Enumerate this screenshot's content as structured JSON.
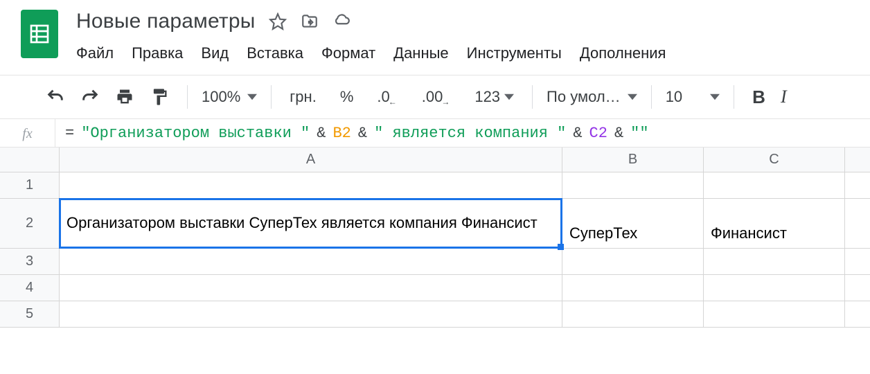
{
  "doc": {
    "title": "Новые параметры"
  },
  "menu": {
    "file": "Файл",
    "edit": "Правка",
    "view": "Вид",
    "insert": "Вставка",
    "format": "Формат",
    "data": "Данные",
    "tools": "Инструменты",
    "addons": "Дополнения"
  },
  "toolbar": {
    "zoom": "100%",
    "currency": "грн.",
    "percent": "%",
    "dec_less": ".0",
    "dec_more": ".00",
    "num_format": "123",
    "font_name": "По умол…",
    "font_size": "10",
    "bold": "B",
    "italic": "I"
  },
  "formula": {
    "fx": "fx",
    "eq": "=",
    "str1": "\"Организатором выставки \"",
    "amp": "&",
    "ref_b2": "B2",
    "str2": "\" является компания \"",
    "ref_c2": "C2",
    "str3": "\"\""
  },
  "columns": {
    "a": "A",
    "b": "B",
    "c": "C"
  },
  "rows": {
    "r1": "1",
    "r2": "2",
    "r3": "3",
    "r4": "4",
    "r5": "5"
  },
  "cells": {
    "a2": "Организатором выставки СуперТех является компания Финансист",
    "b2": "СуперТех",
    "c2": "Финансист"
  }
}
